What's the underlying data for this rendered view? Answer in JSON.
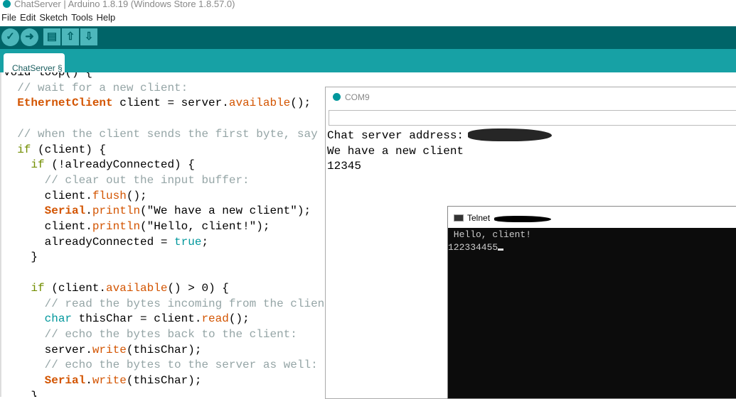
{
  "window": {
    "title": "ChatServer | Arduino 1.8.19 (Windows Store 1.8.57.0)"
  },
  "menu": [
    "File",
    "Edit",
    "Sketch",
    "Tools",
    "Help"
  ],
  "toolbar": {
    "verify": "✓",
    "upload": "➜",
    "new": "▤",
    "open": "⇧",
    "save": "⇩"
  },
  "tab": {
    "label": "ChatServer §"
  },
  "code": [
    [
      [
        "p",
        "void loop() {"
      ]
    ],
    [
      [
        "p",
        "  "
      ],
      [
        "comment",
        "// wait for a new client:"
      ]
    ],
    [
      [
        "p",
        "  "
      ],
      [
        "type",
        "EthernetClient"
      ],
      [
        "p",
        " client = server."
      ],
      [
        "func",
        "available"
      ],
      [
        "p",
        "();"
      ]
    ],
    [
      [
        "p",
        ""
      ]
    ],
    [
      [
        "p",
        "  "
      ],
      [
        "comment",
        "// when the client sends the first byte, say hello:"
      ]
    ],
    [
      [
        "p",
        "  "
      ],
      [
        "ctrl",
        "if"
      ],
      [
        "p",
        " (client) {"
      ]
    ],
    [
      [
        "p",
        "    "
      ],
      [
        "ctrl",
        "if"
      ],
      [
        "p",
        " (!alreadyConnected) {"
      ]
    ],
    [
      [
        "p",
        "      "
      ],
      [
        "comment",
        "// clear out the input buffer:"
      ]
    ],
    [
      [
        "p",
        "      client."
      ],
      [
        "func",
        "flush"
      ],
      [
        "p",
        "();"
      ]
    ],
    [
      [
        "p",
        "      "
      ],
      [
        "type",
        "Serial"
      ],
      [
        "p",
        "."
      ],
      [
        "func",
        "println"
      ],
      [
        "p",
        "(\"We have a new client\");"
      ]
    ],
    [
      [
        "p",
        "      client."
      ],
      [
        "func",
        "println"
      ],
      [
        "p",
        "(\"Hello, client!\");"
      ]
    ],
    [
      [
        "p",
        "      alreadyConnected = "
      ],
      [
        "kw",
        "true"
      ],
      [
        "p",
        ";"
      ]
    ],
    [
      [
        "p",
        "    }"
      ]
    ],
    [
      [
        "p",
        ""
      ]
    ],
    [
      [
        "p",
        "    "
      ],
      [
        "ctrl",
        "if"
      ],
      [
        "p",
        " (client."
      ],
      [
        "func",
        "available"
      ],
      [
        "p",
        "() > 0) {"
      ]
    ],
    [
      [
        "p",
        "      "
      ],
      [
        "comment",
        "// read the bytes incoming from the client:"
      ]
    ],
    [
      [
        "p",
        "      "
      ],
      [
        "kw",
        "char"
      ],
      [
        "p",
        " thisChar = client."
      ],
      [
        "func",
        "read"
      ],
      [
        "p",
        "();"
      ]
    ],
    [
      [
        "p",
        "      "
      ],
      [
        "comment",
        "// echo the bytes back to the client:"
      ]
    ],
    [
      [
        "p",
        "      server."
      ],
      [
        "func",
        "write"
      ],
      [
        "p",
        "(thisChar);"
      ]
    ],
    [
      [
        "p",
        "      "
      ],
      [
        "comment",
        "// echo the bytes to the server as well:"
      ]
    ],
    [
      [
        "p",
        "      "
      ],
      [
        "type",
        "Serial"
      ],
      [
        "p",
        "."
      ],
      [
        "func",
        "write"
      ],
      [
        "p",
        "(thisChar);"
      ]
    ],
    [
      [
        "p",
        "    }"
      ]
    ]
  ],
  "serial_monitor": {
    "title": "COM9",
    "input": "",
    "output": [
      "Chat server address:",
      "We have a new client",
      "12345"
    ]
  },
  "telnet": {
    "title": "Telnet",
    "output": [
      " Hello, client!",
      "122334455"
    ]
  }
}
